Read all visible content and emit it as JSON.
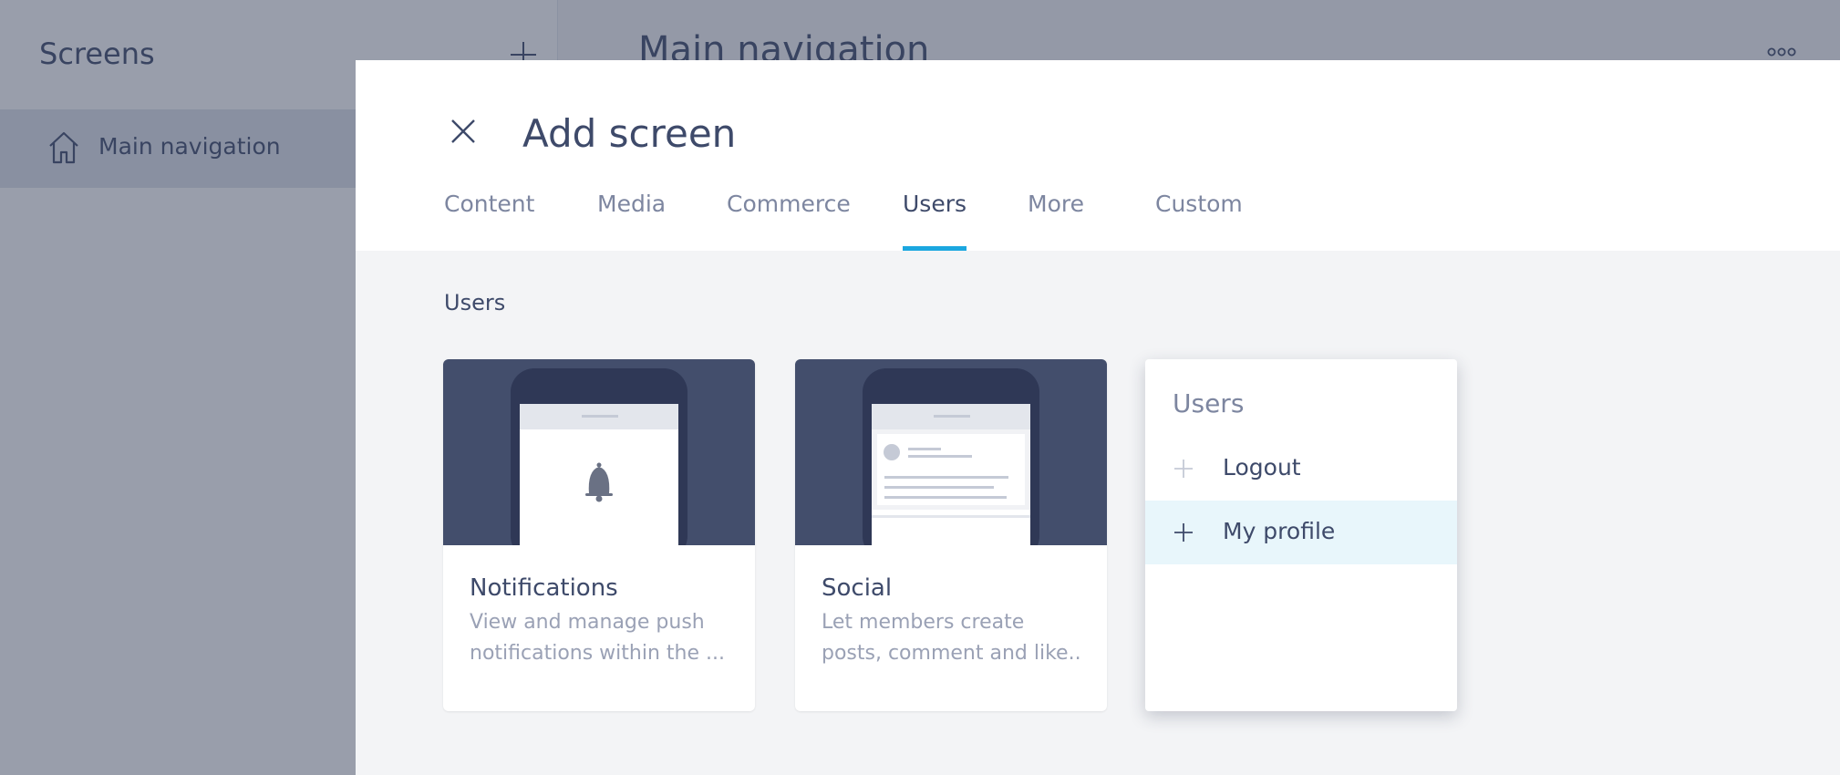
{
  "sidebar": {
    "title": "Screens",
    "items": [
      {
        "label": "Main navigation",
        "icon": "home-icon"
      }
    ]
  },
  "main": {
    "title": "Main navigation"
  },
  "modal": {
    "title": "Add screen",
    "tabs": [
      {
        "label": "Content"
      },
      {
        "label": "Media"
      },
      {
        "label": "Commerce"
      },
      {
        "label": "Users",
        "active": true
      },
      {
        "label": "More"
      },
      {
        "label": "Custom"
      }
    ],
    "section_label": "Users",
    "cards": [
      {
        "title": "Notifications",
        "desc_line1": "View and manage push",
        "desc_line2": "notifications within the ..."
      },
      {
        "title": "Social",
        "desc_line1": "Let members create",
        "desc_line2": "posts, comment and like..."
      }
    ],
    "dropdown": {
      "title": "Users",
      "items": [
        {
          "label": "Logout"
        },
        {
          "label": "My profile"
        }
      ]
    }
  },
  "colors": {
    "accent": "#1ba7e0",
    "text": "#3e4a6a",
    "muted": "#7d86a0",
    "thumb_bg": "#434e6c",
    "hover": "#e8f6fb"
  }
}
